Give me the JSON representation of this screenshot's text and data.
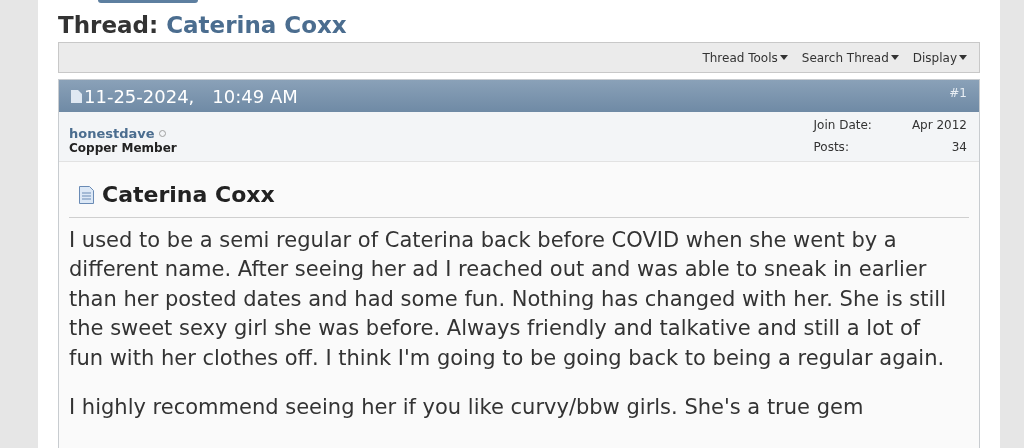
{
  "thread": {
    "label": "Thread:",
    "title": "Caterina Coxx"
  },
  "toolbar": [
    {
      "label": "Thread Tools"
    },
    {
      "label": "Search Thread"
    },
    {
      "label": "Display"
    }
  ],
  "post": {
    "date": "11-25-2024,",
    "time": "10:49 AM",
    "number": "#1",
    "author": {
      "name": "honestdave",
      "online": false,
      "rank": "Copper Member"
    },
    "stats": [
      {
        "label": "Join Date:",
        "value": "Apr 2012"
      },
      {
        "label": "Posts:",
        "value": "34"
      }
    ],
    "title": "Caterina Coxx",
    "paragraphs": [
      "I used to be a semi regular of Caterina back before COVID when she went by a different name. After seeing her ad I reached out and was able to sneak in earlier than her posted dates and had some fun. Nothing has changed with her. She is still the sweet sexy girl she was before. Always friendly and talkative and still a lot of fun with her clothes off. I think I'm going to be going back to being a regular again.",
      "I highly recommend seeing her if you like curvy/bbw girls. She's a true gem"
    ]
  }
}
